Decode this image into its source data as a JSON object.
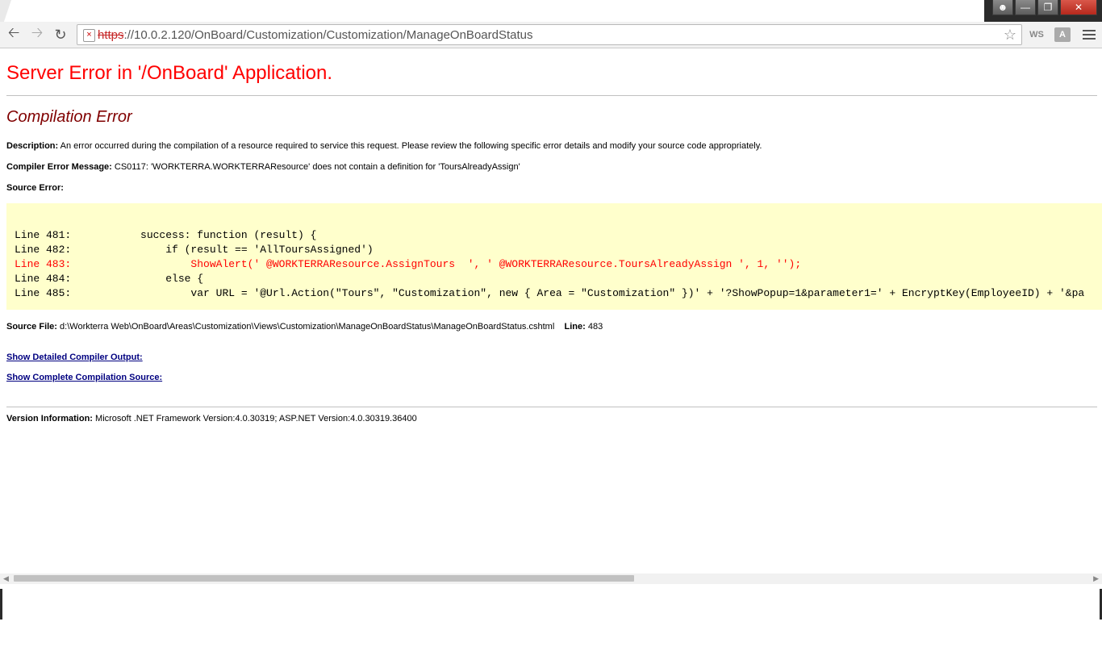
{
  "browser": {
    "url_scheme": "https",
    "url_rest": "://10.0.2.120/OnBoard/Customization/Customization/ManageOnBoardStatus",
    "ext1": "WS",
    "ext2": "A"
  },
  "page": {
    "title": "Server Error in '/OnBoard' Application.",
    "subtitle": "Compilation Error",
    "description_label": "Description:",
    "description_text": "An error occurred during the compilation of a resource required to service this request. Please review the following specific error details and modify your source code appropriately.",
    "compiler_label": "Compiler Error Message:",
    "compiler_text": "CS0117: 'WORKTERRA.WORKTERRAResource' does not contain a definition for 'ToursAlreadyAssign'",
    "source_error_label": "Source Error:",
    "code_lines": [
      "Line 481:           success: function (result) {",
      "Line 482:               if (result == 'AllToursAssigned')",
      "Line 483:                   ShowAlert(' @WORKTERRAResource.AssignTours  ', ' @WORKTERRAResource.ToursAlreadyAssign ', 1, '');",
      "Line 484:               else {",
      "Line 485:                   var URL = '@Url.Action(\"Tours\", \"Customization\", new { Area = \"Customization\" })' + '?ShowPopup=1&parameter1=' + EncryptKey(EmployeeID) + '&pa"
    ],
    "source_file_label": "Source File:",
    "source_file_text": "d:\\Workterra Web\\OnBoard\\Areas\\Customization\\Views\\Customization\\ManageOnBoardStatus\\ManageOnBoardStatus.cshtml",
    "line_label": "Line:",
    "line_value": "483",
    "link_compiler_output": "Show Detailed Compiler Output:",
    "link_compilation_source": "Show Complete Compilation Source:",
    "version_label": "Version Information:",
    "version_text": "Microsoft .NET Framework Version:4.0.30319; ASP.NET Version:4.0.30319.36400"
  }
}
